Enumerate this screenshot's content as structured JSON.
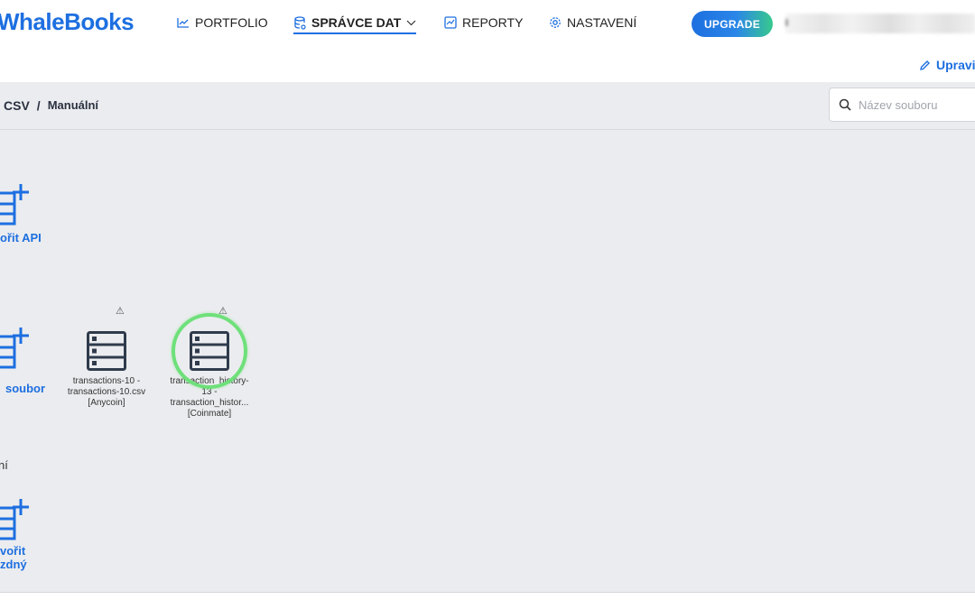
{
  "app": {
    "logo": "WhaleBooks"
  },
  "nav": {
    "portfolio": "PORTFOLIO",
    "data_manager": "SPRÁVCE DAT",
    "reports": "REPORTY",
    "settings": "NASTAVENÍ",
    "upgrade": "UPGRADE"
  },
  "toolbar": {
    "edit": "Upravi"
  },
  "breadcrumb": {
    "part1": "CSV",
    "separator": "/",
    "part2": "Manuální"
  },
  "search": {
    "placeholder": "Název souboru"
  },
  "tiles": {
    "api_label": "ořit API",
    "file_label": "soubor",
    "empty_label_line1": "vořit",
    "empty_label_line2": "zdný"
  },
  "section": {
    "manual_label": "ní"
  },
  "files": [
    {
      "line1": "transactions-10 -",
      "line2": "transactions-10.csv",
      "line3": "[Anycoin]",
      "line4": ""
    },
    {
      "line1": "transaction_history-",
      "line2": "13 -",
      "line3": "transaction_histor...",
      "line4": "[Coinmate]"
    }
  ],
  "warning_symbol": "⚠",
  "colors": {
    "accent": "#1d6fe0",
    "highlight": "#6ee07a",
    "background": "#ebecef"
  }
}
